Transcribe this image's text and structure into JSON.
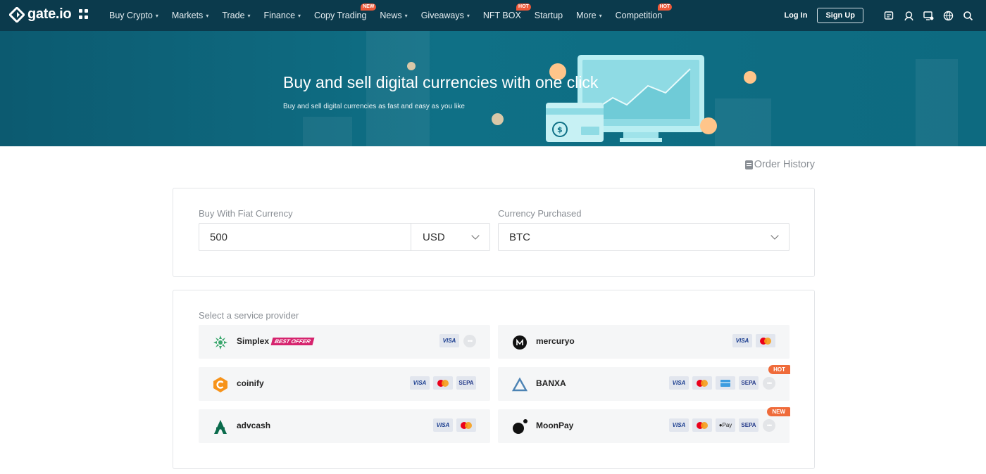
{
  "nav": {
    "logo_text": "gate.io",
    "menu": [
      {
        "label": "Buy Crypto",
        "caret": true,
        "badge": ""
      },
      {
        "label": "Markets",
        "caret": true,
        "badge": ""
      },
      {
        "label": "Trade",
        "caret": true,
        "badge": ""
      },
      {
        "label": "Finance",
        "caret": true,
        "badge": ""
      },
      {
        "label": "Copy Trading",
        "caret": false,
        "badge": "NEW"
      },
      {
        "label": "News",
        "caret": true,
        "badge": ""
      },
      {
        "label": "Giveaways",
        "caret": true,
        "badge": ""
      },
      {
        "label": "NFT BOX",
        "caret": false,
        "badge": "HOT"
      },
      {
        "label": "Startup",
        "caret": false,
        "badge": ""
      },
      {
        "label": "More",
        "caret": true,
        "badge": ""
      },
      {
        "label": "Competition",
        "caret": false,
        "badge": "HOT"
      }
    ],
    "login_label": "Log In",
    "signup_label": "Sign Up",
    "icons": [
      "market-icon",
      "support-icon",
      "download-icon",
      "language-icon",
      "search-icon"
    ]
  },
  "hero": {
    "title": "Buy and sell digital currencies with one click",
    "subtitle": "Buy and sell digital currencies as fast and easy as you like"
  },
  "order_history_label": "Order History",
  "form": {
    "fiat_label": "Buy With Fiat Currency",
    "amount_value": "500",
    "fiat_currency": "USD",
    "crypto_label": "Currency Purchased",
    "crypto_currency": "BTC"
  },
  "providers_section": {
    "title": "Select a service provider",
    "providers": [
      {
        "name": "Simplex",
        "offer": "BEST OFFER",
        "tag": "",
        "methods": [
          "visa",
          "more"
        ]
      },
      {
        "name": "mercuryo",
        "offer": "",
        "tag": "",
        "methods": [
          "visa",
          "mastercard"
        ]
      },
      {
        "name": "coinify",
        "offer": "",
        "tag": "",
        "methods": [
          "visa",
          "mastercard",
          "sepa"
        ]
      },
      {
        "name": "BANXA",
        "offer": "",
        "tag": "HOT",
        "methods": [
          "visa",
          "mastercard",
          "card",
          "sepa",
          "more"
        ]
      },
      {
        "name": "advcash",
        "offer": "",
        "tag": "",
        "methods": [
          "visa",
          "mastercard"
        ]
      },
      {
        "name": "MoonPay",
        "offer": "",
        "tag": "NEW",
        "methods": [
          "visa",
          "mastercard",
          "applepay",
          "sepa",
          "more"
        ]
      }
    ],
    "method_labels": {
      "visa": "VISA",
      "sepa": "SEPA",
      "applepay": "Pay"
    }
  },
  "colors": {
    "nav_bg": "#0b3a4c",
    "hero_bg": "#0f7086",
    "badge": "#ef5a3a",
    "offer_badge": "#d6246e"
  }
}
